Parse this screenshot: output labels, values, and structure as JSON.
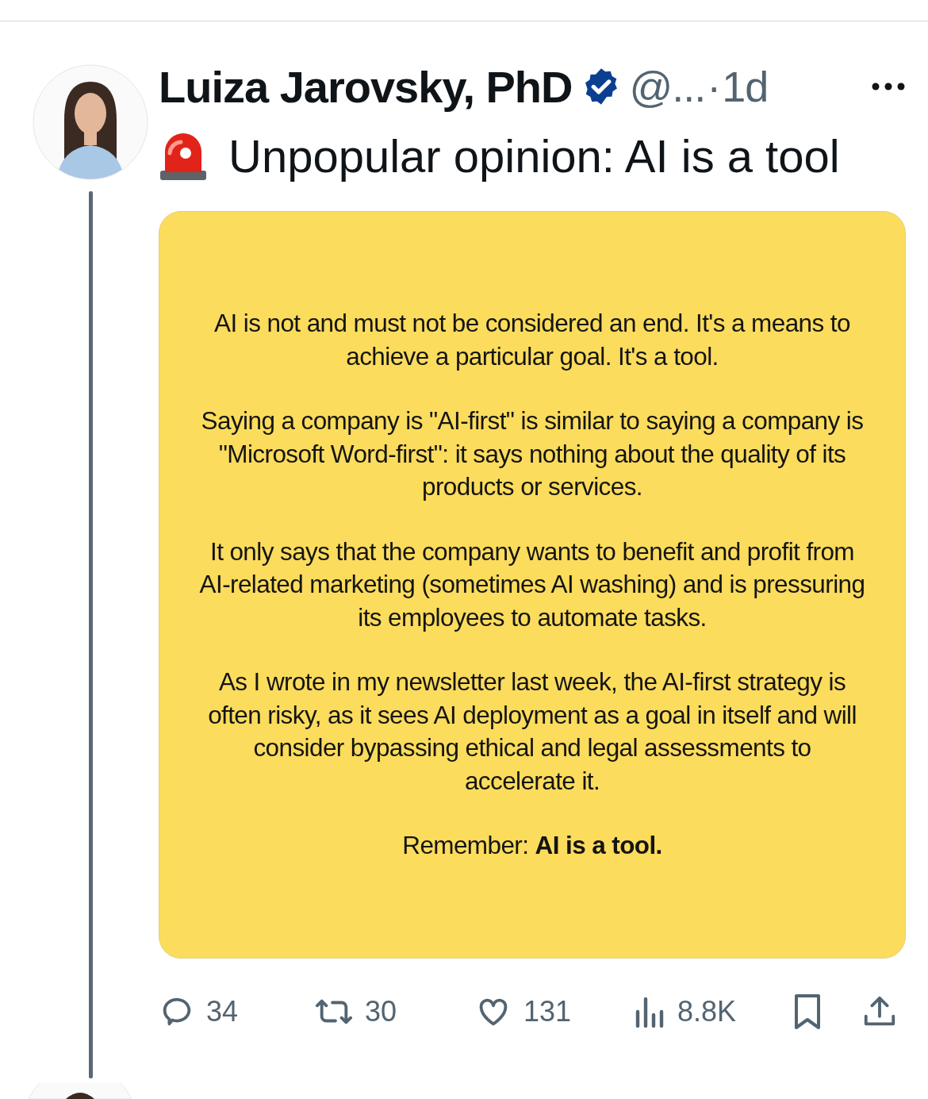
{
  "post": {
    "author": "Luiza Jarovsky, PhD",
    "verified": true,
    "handle": "@...",
    "separator": "·",
    "time": "1d",
    "text": "Unpopular opinion: AI is a tool",
    "image_card": {
      "paragraphs": [
        "AI is not and must not be considered an end. It's a means to achieve a particular goal. It's a tool.",
        "Saying a company is \"AI-first\" is similar to saying a company is \"Microsoft Word-first\": it says nothing about the quality of its products or services.",
        "It only says that the company wants to benefit and profit from AI-related marketing (sometimes AI washing) and is pressuring its employees to automate tasks.",
        "As I wrote in my newsletter last week, the AI-first strategy is often risky, as it sees AI deployment as a goal in itself and will consider bypassing ethical and legal assessments to accelerate it.",
        "Remember: **AI is a tool.**"
      ]
    },
    "actions": [
      {
        "kind": "reply",
        "count": "34"
      },
      {
        "kind": "repost",
        "count": "30"
      },
      {
        "kind": "like",
        "count": "131"
      },
      {
        "kind": "views",
        "count": "8.8K"
      },
      {
        "kind": "bookmark"
      },
      {
        "kind": "share"
      }
    ]
  }
}
